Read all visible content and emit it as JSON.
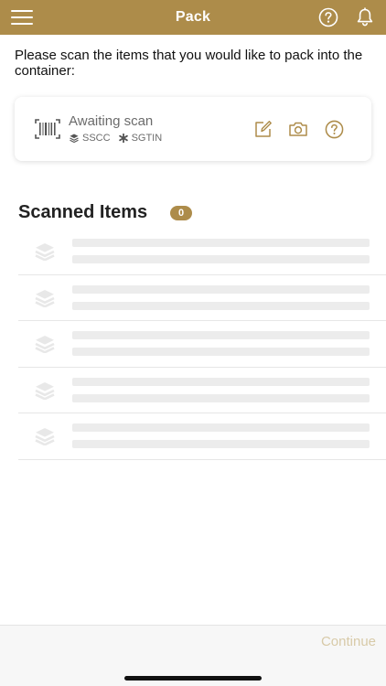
{
  "header": {
    "title": "Pack"
  },
  "instruction": "Please scan the items that you would like to pack into the container:",
  "scan_card": {
    "status": "Awaiting scan",
    "tags": [
      {
        "icon": "layers-icon",
        "label": "SSCC"
      },
      {
        "icon": "asterisk-icon",
        "label": "SGTIN"
      }
    ]
  },
  "scanned_items": {
    "title": "Scanned Items",
    "count": "0",
    "placeholder_rows": 5
  },
  "footer": {
    "continue_label": "Continue"
  },
  "colors": {
    "accent": "#ad8c4a",
    "disabled_text": "#d8caa8",
    "placeholder": "#ececec",
    "muted_text": "#6b6b6b"
  }
}
